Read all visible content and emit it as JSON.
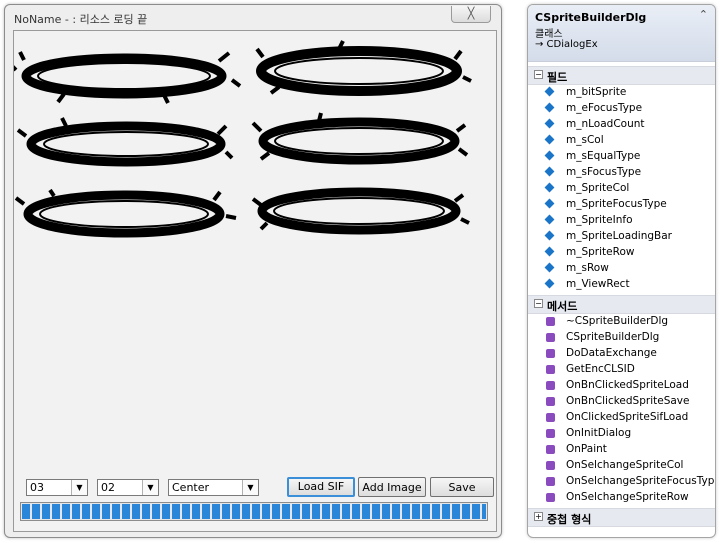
{
  "dialog": {
    "title": "NoName - : 리소스 로딩 끝",
    "close_label": "╳",
    "combo_col": "03",
    "combo_row": "02",
    "combo_focus": "Center",
    "load_sif_label": "Load SIF",
    "add_image_label": "Add Image",
    "save_label": "Save",
    "progress_percent": 100
  },
  "class_view": {
    "class_name": "CSpriteBuilderDlg",
    "class_kind": "클래스",
    "base_class": "→ CDialogEx",
    "collapse_icon": "chevron-double-up-icon",
    "fields_section": "필드",
    "fields": [
      "m_bitSprite",
      "m_eFocusType",
      "m_nLoadCount",
      "m_sCol",
      "m_sEqualType",
      "m_sFocusType",
      "m_SpriteCol",
      "m_SpriteFocusType",
      "m_SpriteInfo",
      "m_SpriteLoadingBar",
      "m_SpriteRow",
      "m_sRow",
      "m_ViewRect"
    ],
    "methods_section": "메서드",
    "methods": [
      "~CSpriteBuilderDlg",
      "CSpriteBuilderDlg",
      "DoDataExchange",
      "GetEncCLSID",
      "OnBnClickedSpriteLoad",
      "OnBnClickedSpriteSave",
      "OnClickedSpriteSifLoad",
      "OnInitDialog",
      "OnPaint",
      "OnSelchangeSpriteCol",
      "OnSelchangeSpriteFocusType",
      "OnSelchangeSpriteRow"
    ],
    "nested_section": "중첩 형식",
    "field_icon_color": "#1a74c7",
    "method_icon_color": "#8a4bbf"
  }
}
